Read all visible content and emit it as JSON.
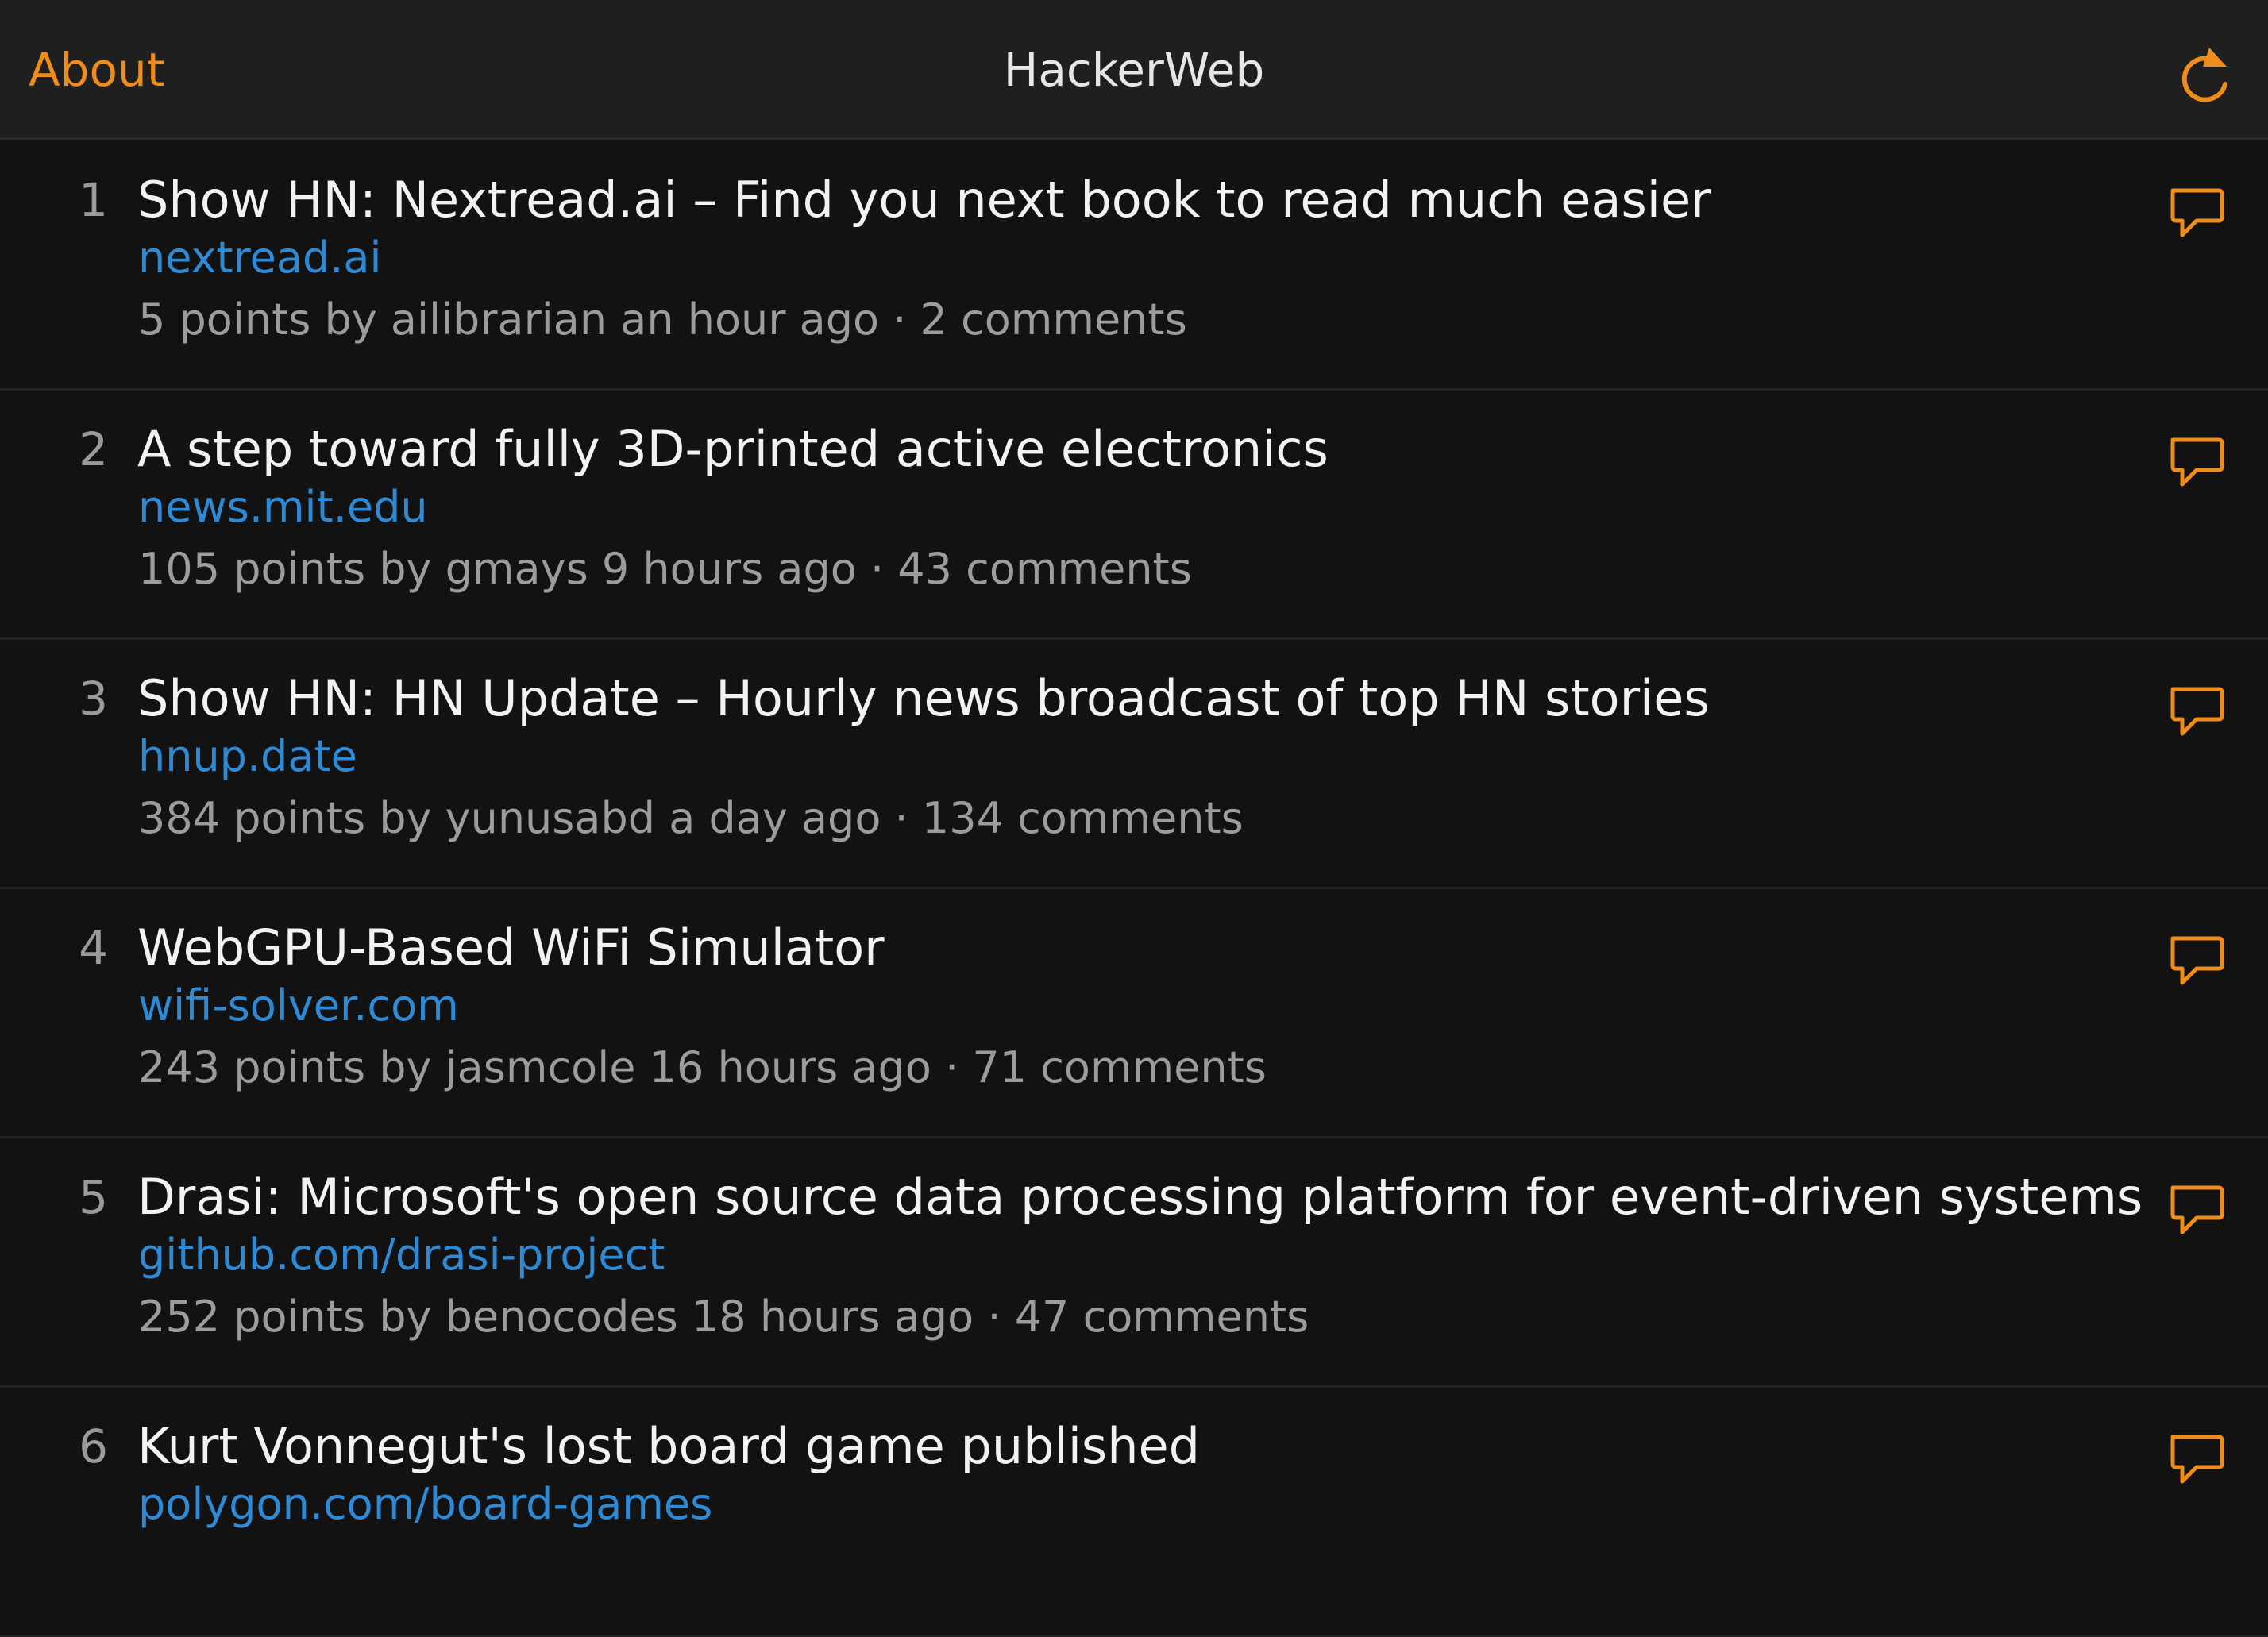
{
  "header": {
    "about_label": "About",
    "title": "HackerWeb",
    "refresh_icon": "refresh-icon",
    "accent_color": "#ee8c1c"
  },
  "stories": [
    {
      "rank": "1",
      "title": "Show HN: Nextread.ai – Find you next book to read much easier",
      "domain": "nextread.ai",
      "meta": "5 points by ailibrarian an hour ago · 2 comments"
    },
    {
      "rank": "2",
      "title": "A step toward fully 3D-printed active electronics",
      "domain": "news.mit.edu",
      "meta": "105 points by gmays 9 hours ago · 43 comments"
    },
    {
      "rank": "3",
      "title": "Show HN: HN Update – Hourly news broadcast of top HN stories",
      "domain": "hnup.date",
      "meta": "384 points by yunusabd a day ago · 134 comments"
    },
    {
      "rank": "4",
      "title": "WebGPU-Based WiFi Simulator",
      "domain": "wifi-solver.com",
      "meta": "243 points by jasmcole 16 hours ago · 71 comments"
    },
    {
      "rank": "5",
      "title": "Drasi: Microsoft's open source data processing platform for event-driven systems",
      "domain": "github.com/drasi-project",
      "meta": "252 points by benocodes 18 hours ago · 47 comments"
    },
    {
      "rank": "6",
      "title": "Kurt Vonnegut's lost board game published",
      "domain": "polygon.com/board-games",
      "meta": ""
    }
  ],
  "comments_icon": "speech-bubble-icon",
  "colors": {
    "background": "#121212",
    "header_background": "#1f1f1f",
    "title_text": "#f2f2f2",
    "domain_link": "#2f8ad6",
    "meta_text": "#9c9c9c"
  }
}
